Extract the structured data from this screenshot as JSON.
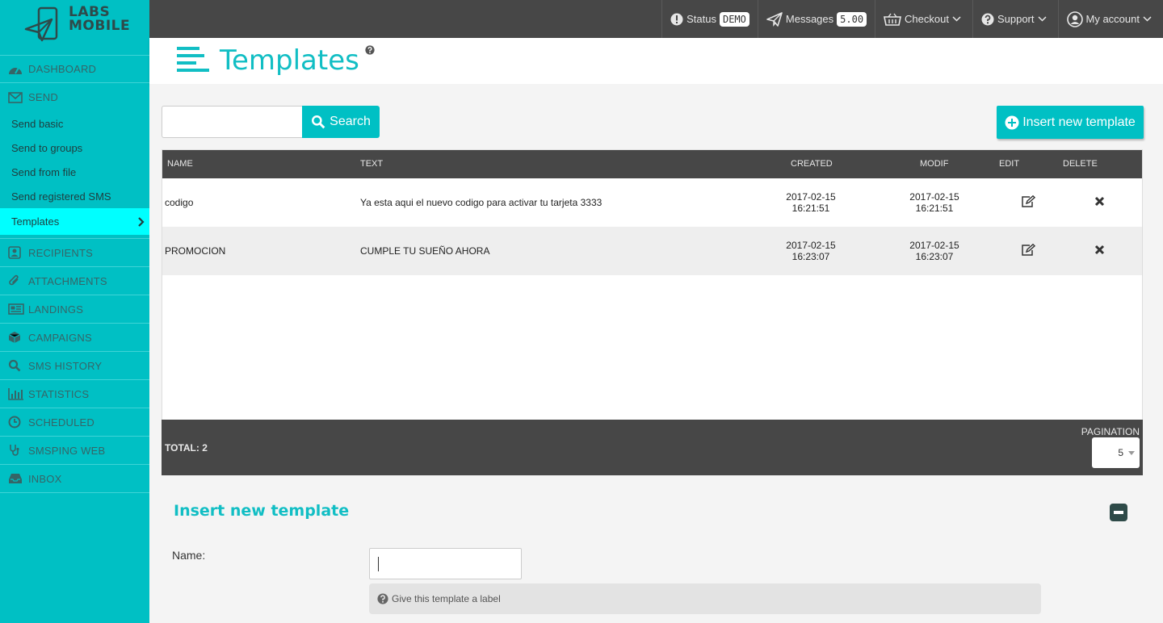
{
  "logo": {
    "line1": "LABS",
    "line2": "MOBILE"
  },
  "sidebar": {
    "dashboard": "DASHBOARD",
    "send": "SEND",
    "send_items": [
      "Send basic",
      "Send to groups",
      "Send from file",
      "Send registered SMS",
      "Templates"
    ],
    "items": [
      "RECIPIENTS",
      "ATTACHMENTS",
      "LANDINGS",
      "CAMPAIGNS",
      "SMS HISTORY",
      "STATISTICS",
      "SCHEDULED",
      "SMSPING WEB",
      "INBOX"
    ]
  },
  "topbar": {
    "status_label": "Status",
    "status_badge": "DEMO",
    "messages_label": "Messages",
    "messages_badge": "5.00",
    "checkout": "Checkout",
    "support": "Support",
    "account": "My account"
  },
  "header": {
    "title": "Templates"
  },
  "toolbar": {
    "search_label": "Search",
    "insert_label": "Insert new template"
  },
  "table": {
    "columns": [
      "NAME",
      "TEXT",
      "CREATED",
      "MODIF",
      "EDIT",
      "DELETE"
    ],
    "rows": [
      {
        "name": "codigo",
        "text": "Ya esta aqui el nuevo codigo para activar tu tarjeta 3333",
        "created_date": "2017-02-15",
        "created_time": "16:21:51",
        "modif_date": "2017-02-15",
        "modif_time": "16:21:51"
      },
      {
        "name": "PROMOCION",
        "text": "CUMPLE TU SUEÑO AHORA",
        "created_date": "2017-02-15",
        "created_time": "16:23:07",
        "modif_date": "2017-02-15",
        "modif_time": "16:23:07"
      }
    ],
    "total": "TOTAL: 2",
    "pagination_label": "PAGINATION",
    "pagination_value": "5"
  },
  "form": {
    "title": "Insert new template",
    "name_label": "Name:",
    "name_value": "",
    "help_text": "Give this template a label"
  },
  "colors": {
    "accent": "#00c0c4",
    "active": "#00ffff",
    "dark": "#474747"
  }
}
